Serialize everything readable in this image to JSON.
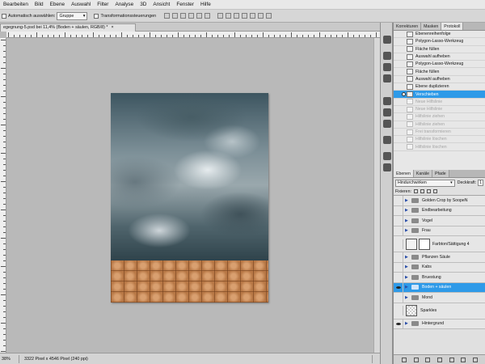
{
  "menu": [
    "Bearbeiten",
    "Bild",
    "Ebene",
    "Auswahl",
    "Filter",
    "Analyse",
    "3D",
    "Ansicht",
    "Fenster",
    "Hilfe"
  ],
  "options": {
    "auto_select_label": "Automatisch auswählen:",
    "auto_select_value": "Gruppe",
    "transform_label": "Transformationssteuerungen"
  },
  "document_tab": {
    "title": "egegnung-5.psd bei 11,4% (Boden + säulen, RGB/8) *",
    "close": "×"
  },
  "status": {
    "zoom": "38%",
    "info": "3322 Pixel x 4546 Pixel (240 ppi)"
  },
  "history_panel": {
    "tabs": [
      "Korrekturen",
      "Masken",
      "Protokoll"
    ],
    "active_tab": "Protokoll",
    "items": [
      {
        "label": "Ebenenreihenfolge",
        "state": "normal"
      },
      {
        "label": "Polygon-Lasso-Werkzeug",
        "state": "normal"
      },
      {
        "label": "Fläche füllen",
        "state": "normal"
      },
      {
        "label": "Auswahl aufheben",
        "state": "normal"
      },
      {
        "label": "Polygon-Lasso-Werkzeug",
        "state": "normal"
      },
      {
        "label": "Fläche füllen",
        "state": "normal"
      },
      {
        "label": "Auswahl aufheben",
        "state": "normal"
      },
      {
        "label": "Ebene duplizieren",
        "state": "normal"
      },
      {
        "label": "Verschieben",
        "state": "selected"
      },
      {
        "label": "Neue Hilfslinie",
        "state": "dim"
      },
      {
        "label": "Neue Hilfslinie",
        "state": "dim"
      },
      {
        "label": "Hilfslinie ziehen",
        "state": "dim"
      },
      {
        "label": "Hilfslinie ziehen",
        "state": "dim"
      },
      {
        "label": "Frei transformieren",
        "state": "dim"
      },
      {
        "label": "Hilfslinie löschen",
        "state": "dim"
      },
      {
        "label": "Hilfslinie löschen",
        "state": "dim"
      }
    ]
  },
  "layers_panel": {
    "tabs": [
      "Ebenen",
      "Kanäle",
      "Pfade"
    ],
    "active_tab": "Ebenen",
    "blend_mode": "Hindurchwirken",
    "opacity_label": "Deckkraft:",
    "opacity_value": "1",
    "lock_label": "Fixieren:",
    "layers": [
      {
        "name": "Golden Crop by SoopeN",
        "type": "group",
        "visible": false,
        "selected": false
      },
      {
        "name": "Endbearbeitung",
        "type": "group",
        "visible": false,
        "selected": false
      },
      {
        "name": "Vogel",
        "type": "group",
        "visible": false,
        "selected": false
      },
      {
        "name": "Frau",
        "type": "group",
        "visible": false,
        "selected": false
      },
      {
        "name": "Farbton/Sättigung 4",
        "type": "adjustment",
        "visible": false,
        "selected": false
      },
      {
        "name": "Pflanzen Säule",
        "type": "group",
        "visible": false,
        "selected": false
      },
      {
        "name": "Kabs",
        "type": "group",
        "visible": false,
        "selected": false
      },
      {
        "name": "Bruestung",
        "type": "group",
        "visible": false,
        "selected": false
      },
      {
        "name": "Boden + säulen",
        "type": "group",
        "visible": true,
        "selected": true
      },
      {
        "name": "Mond",
        "type": "group",
        "visible": false,
        "selected": false
      },
      {
        "name": "Sparkles",
        "type": "pixel",
        "visible": false,
        "selected": false
      },
      {
        "name": "Hintergrund",
        "type": "group",
        "visible": true,
        "selected": false
      }
    ]
  },
  "colors": {
    "selection": "#2e9ae8",
    "panel_bg": "#e0e0e0",
    "canvas_bg": "#b9b9b9"
  }
}
